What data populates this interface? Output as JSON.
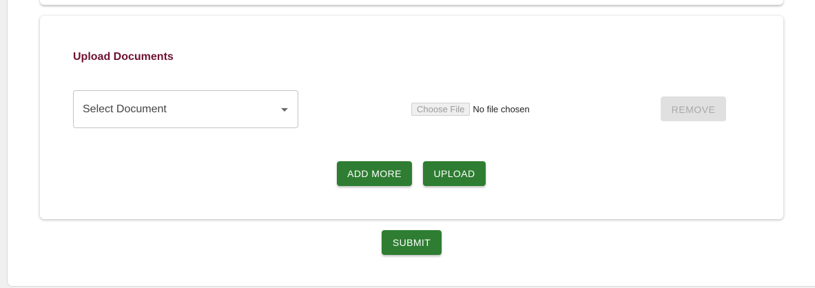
{
  "upload_section": {
    "title": "Upload Documents",
    "document_select": {
      "label": "Select Document",
      "icon": "chevron-down-icon"
    },
    "file_input": {
      "button_label": "Choose File",
      "status": "No file chosen"
    },
    "remove_label": "REMOVE",
    "add_more_label": "ADD MORE",
    "upload_label": "UPLOAD"
  },
  "form": {
    "submit_label": "SUBMIT"
  },
  "colors": {
    "title": "#6d1230",
    "primary_button": "#2e7d32",
    "disabled_button": "#e0e0e0"
  }
}
